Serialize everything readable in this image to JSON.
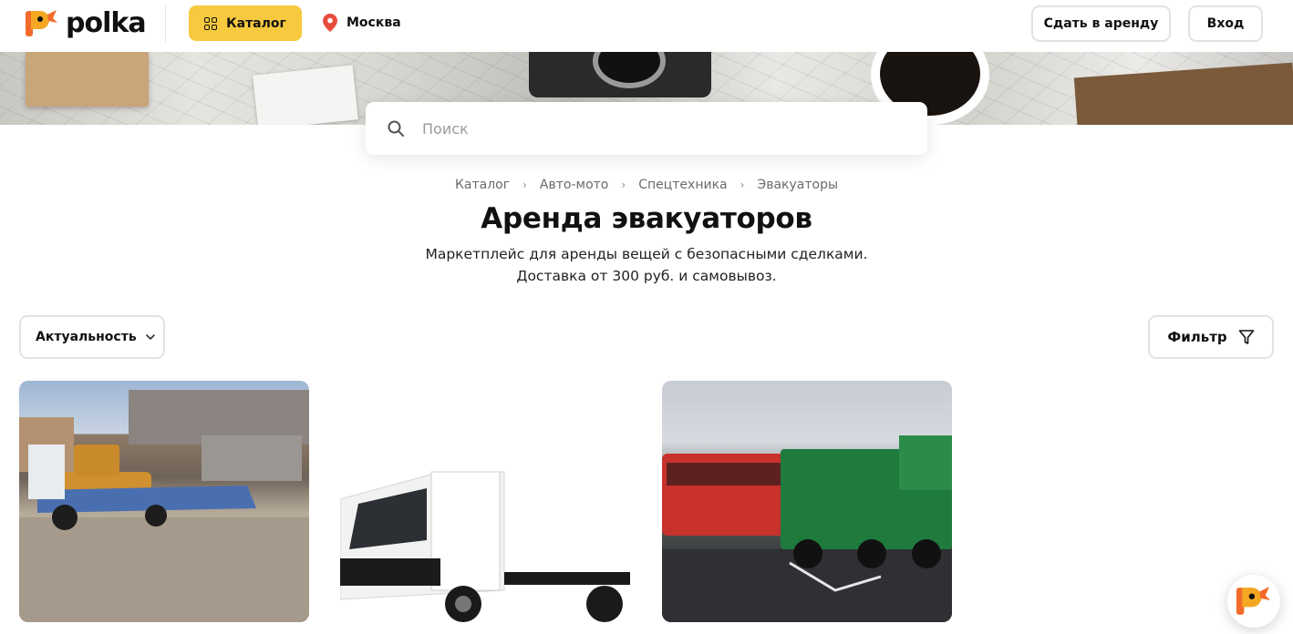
{
  "header": {
    "logo_text": "polka",
    "catalog_label": "Каталог",
    "city_label": "Москва",
    "rent_button_label": "Сдать в аренду",
    "login_button_label": "Вход"
  },
  "search": {
    "placeholder": "Поиск"
  },
  "breadcrumb": {
    "items": [
      "Каталог",
      "Авто-мото",
      "Спецтехника",
      "Эвакуаторы"
    ]
  },
  "page": {
    "title": "Аренда эвакуаторов",
    "subtitle_line1": "Маркетплейс для аренды вещей с безопасными сделками.",
    "subtitle_line2": "Доставка от 300 руб. и самовывоз."
  },
  "controls": {
    "sort_label": "Актуальность",
    "filter_label": "Фильтр"
  },
  "colors": {
    "accent_yellow": "#f7c93f",
    "brand_orange": "#f26b2b",
    "pin_red": "#e84c3d",
    "border_gray": "#e2e2e2"
  },
  "icons": {
    "catalog": "grid-icon",
    "city": "location-pin-icon",
    "search": "search-icon",
    "sort": "chevron-down-icon",
    "filter": "filter-funnel-icon"
  },
  "cards": [
    {
      "image": "tow-truck-with-gazelle-photo"
    },
    {
      "image": "white-hyundai-chassis-truck-photo"
    },
    {
      "image": "green-tow-truck-and-red-bus-photo"
    }
  ]
}
